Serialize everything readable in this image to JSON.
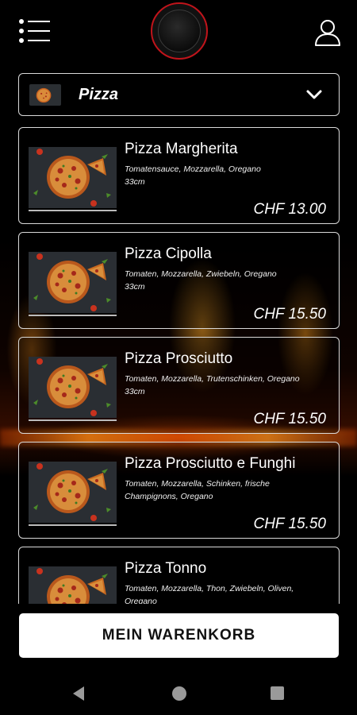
{
  "header": {
    "menu_icon": "menu-list-icon",
    "logo_icon": "restaurant-logo",
    "user_icon": "user-icon",
    "accent_color": "#c0141b"
  },
  "category": {
    "label": "Pizza",
    "icon": "chevron-down-icon"
  },
  "products": [
    {
      "name": "Pizza Margherita",
      "description": "Tomatensauce, Mozzarella, Oregano\n33cm",
      "price": "CHF 13.00"
    },
    {
      "name": "Pizza Cipolla",
      "description": "Tomaten, Mozzarella, Zwiebeln, Oregano\n33cm",
      "price": "CHF 15.50"
    },
    {
      "name": "Pizza Prosciutto",
      "description": "Tomaten, Mozzarella, Trutenschinken, Oregano\n33cm",
      "price": "CHF 15.50"
    },
    {
      "name": "Pizza Prosciutto e Funghi",
      "description": "Tomaten, Mozzarella, Schinken, frische Champignons, Oregano",
      "price": "CHF 15.50"
    },
    {
      "name": "Pizza Tonno",
      "description": "Tomaten, Mozzarella, Thon, Zwiebeln, Oliven, Oregano",
      "price": ""
    }
  ],
  "cart": {
    "label": "MEIN WARENKORB"
  },
  "navbar": {
    "back_icon": "back-icon",
    "home_icon": "home-icon",
    "recent_icon": "recent-apps-icon"
  }
}
